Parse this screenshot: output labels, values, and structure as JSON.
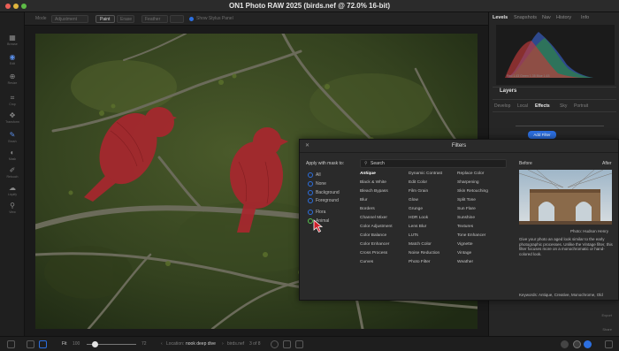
{
  "window": {
    "title": "ON1 Photo RAW 2025 (birds.nef @ 72.0% 16-bit)"
  },
  "toolbar": {
    "mode_label": "Mode",
    "mode_value": "Adjustment",
    "paint_label": "Paint",
    "erase_label": "Erase",
    "feather_label": "Feather",
    "show_stylus_label": "Show Stylus Panel"
  },
  "left_tools": [
    {
      "icon": "browse-icon",
      "label": "Browse"
    },
    {
      "icon": "develop-icon",
      "label": "Edit"
    },
    {
      "icon": "zoom-icon",
      "label": "Resize"
    },
    {
      "icon": "crop-icon",
      "label": "Crop"
    },
    {
      "icon": "transform-icon",
      "label": "Transform"
    },
    {
      "icon": "brush-icon",
      "label": "Brush"
    },
    {
      "icon": "mask-icon",
      "label": "Mask"
    },
    {
      "icon": "retouch-icon",
      "label": "Retouch"
    },
    {
      "icon": "liquify-icon",
      "label": "Liquify"
    },
    {
      "icon": "view-icon",
      "label": "View"
    }
  ],
  "right_panel": {
    "tabs": [
      "Levels",
      "Snapshots",
      "Nav",
      "History",
      "Info"
    ],
    "histogram_info": "Red 1.43   Green 1.35   Blue 1.63",
    "layers_label": "Layers",
    "sub_tabs": [
      "Develop",
      "Local",
      "Effects",
      "Sky",
      "Portrait"
    ],
    "active_sub_tab": "Effects",
    "add_filter_label": "Add Filter",
    "side_labels": [
      "Export",
      "Share"
    ]
  },
  "filters_dialog": {
    "title": "Filters",
    "apply_with_mask_label": "Apply with mask to:",
    "mask_options": [
      "All",
      "None",
      "Background",
      "Foreground",
      "Flora",
      "Animal"
    ],
    "selected_mask": "Animal",
    "search_placeholder": "Search",
    "columns": [
      [
        "Antique",
        "Black & White",
        "Bleach Bypass",
        "Blur",
        "Borders",
        "Channel Mixer",
        "Color Adjustment",
        "Color Balance",
        "Color Enhancer",
        "Cross Process",
        "Curves"
      ],
      [
        "Dynamic Contrast",
        "Edit Color",
        "Film Grain",
        "Glow",
        "Grunge",
        "HDR Look",
        "Lens Blur",
        "LUTs",
        "Match Color",
        "Noise Reduction",
        "Photo Filter"
      ],
      [
        "Replace Color",
        "Sharpening",
        "Skin Retouching",
        "Split Tone",
        "Sun Flare",
        "Sunshine",
        "Textures",
        "Tone Enhancer",
        "Vignette",
        "Vintage",
        "Weather"
      ]
    ],
    "highlighted_filter": "Antique",
    "before_label": "Before",
    "after_label": "After",
    "photo_credit": "Photo: Hudson Henry",
    "description": "Give your photo an aged look similar to the early photographic processes. Unlike the Vintage filter, this filter focuses more on a monochromatic or hand-colored look.",
    "keywords": "Keywords: Antique, Creative, Monochrome, Old"
  },
  "bottom_bar": {
    "fit_label": "Fit",
    "zoom_value": "100",
    "zoom_max": "72",
    "location_label": "Location:",
    "location_value": "nook deep dive",
    "file_name": "birds.nef",
    "file_count": "3 of 8"
  },
  "colors": {
    "accent": "#2c6fe0",
    "selected_radio": "#58c44f",
    "mask_overlay": "#b3272f"
  }
}
